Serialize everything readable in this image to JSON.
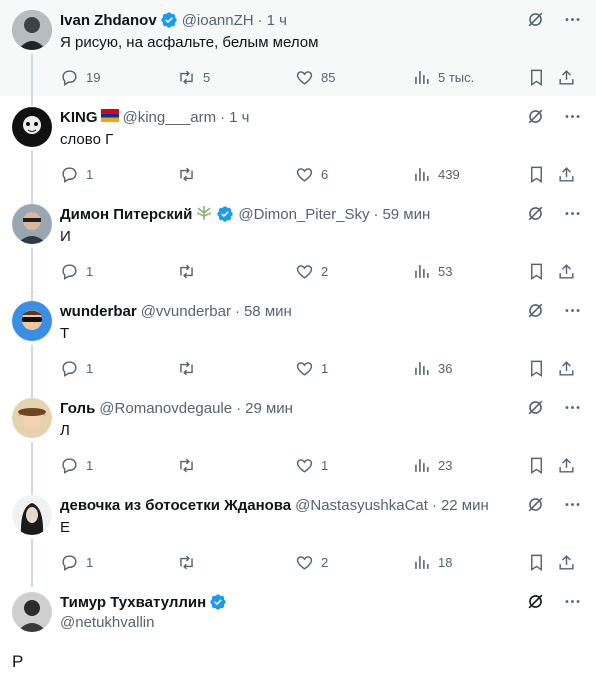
{
  "tweets": [
    {
      "name": "Ivan Zhdanov",
      "handle": "@ioannZH",
      "time": "1 ч",
      "text": "Я рисую, на асфальте, белым мелом",
      "replies": "19",
      "retweets": "5",
      "likes": "85",
      "views": "5 тыс.",
      "verified": true,
      "badge": ""
    },
    {
      "name": "KING",
      "handle": "@king___arm",
      "time": "1 ч",
      "text": "слово Г",
      "replies": "1",
      "retweets": "",
      "likes": "6",
      "views": "439",
      "verified": false,
      "badge": "armenia-flag"
    },
    {
      "name": "Димон Питерский",
      "handle": "@Dimon_Piter_Sky",
      "time": "59 мин",
      "text": "И",
      "replies": "1",
      "retweets": "",
      "likes": "2",
      "views": "53",
      "verified": true,
      "badge": "leaf"
    },
    {
      "name": "wunderbar",
      "handle": "@vvunderbar",
      "time": "58 мин",
      "text": "Т",
      "replies": "1",
      "retweets": "",
      "likes": "1",
      "views": "36",
      "verified": false,
      "badge": ""
    },
    {
      "name": "Голь",
      "handle": "@Romanovdegaule",
      "time": "29 мин",
      "text": "Л",
      "replies": "1",
      "retweets": "",
      "likes": "1",
      "views": "23",
      "verified": false,
      "badge": ""
    },
    {
      "name": "девочка из ботосетки Жданова",
      "handle": "@NastasyushkaCat",
      "time": "22 мин",
      "text": "Е",
      "replies": "1",
      "retweets": "",
      "likes": "2",
      "views": "18",
      "verified": false,
      "badge": ""
    }
  ],
  "last": {
    "name": "Тимур Тухватуллин",
    "handle": "@netukhvallin",
    "text": "Р",
    "verified": true
  },
  "separator": "·",
  "colors": {
    "accent": "#1d9bf0",
    "muted": "#536471",
    "line": "#cfd9de",
    "highlight": "#f7f9f9"
  }
}
